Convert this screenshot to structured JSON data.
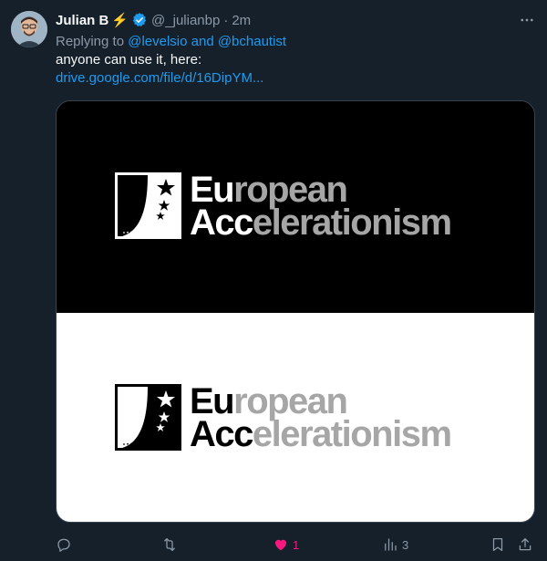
{
  "tweet": {
    "display_name": "Julian B",
    "handle": "@_julianbp",
    "separator": "·",
    "time": "2m",
    "replying_prefix": "Replying to ",
    "replying_to": "@levelsio and @bchautist",
    "text": "anyone can use it, here:",
    "link": "drive.google.com/file/d/16DipYM..."
  },
  "media": {
    "logo_top": {
      "line1_strong": "Eu",
      "line1_soft": "ropean",
      "line2_strong": "Acc",
      "line2_soft": "elerationism"
    },
    "logo_bottom": {
      "line1_strong": "Eu",
      "line1_soft": "ropean",
      "line2_strong": "Acc",
      "line2_soft": "elerationism"
    }
  },
  "actions": {
    "reply_count": "",
    "retweet_count": "",
    "like_count": "1",
    "views_count": "3"
  },
  "colors": {
    "background": "#15202b",
    "link": "#1d9bf0",
    "like": "#f91880",
    "muted": "#8b98a5",
    "verified": "#1d9bf0",
    "bolt": "#f5c518"
  },
  "icons": [
    "avatar",
    "lightning-bolt-icon",
    "verified-badge-icon",
    "more-icon",
    "reply-icon",
    "retweet-icon",
    "heart-icon",
    "views-icon",
    "bookmark-icon",
    "share-icon"
  ]
}
